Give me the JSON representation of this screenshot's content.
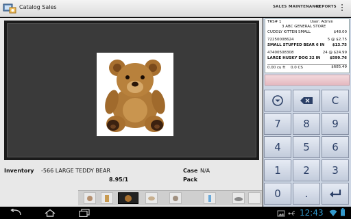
{
  "app": {
    "title": "Catalog Sales",
    "icon": "catalog-app-icon"
  },
  "menu": {
    "sales": "SALES",
    "maintenance": "MAINTENANCE",
    "reports": "REPORTS"
  },
  "product": {
    "image_icon": "teddy-bear-photo",
    "inventory_label": "Inventory",
    "inventory_value": "-566 LARGE TEDDY BEAR",
    "price": "8.95/1",
    "case_label": "Case",
    "case_value": "N/A",
    "pack_label": "Pack"
  },
  "thumbnails": [
    {
      "name": "thumb-1"
    },
    {
      "name": "thumb-2"
    },
    {
      "name": "thumb-3"
    },
    {
      "name": "thumb-4"
    },
    {
      "name": "thumb-5"
    },
    {
      "name": "thumb-6"
    },
    {
      "name": "thumb-7"
    },
    {
      "name": "thumb-8"
    }
  ],
  "receipt": {
    "trs": "TRS# 1",
    "user": "User: Admin",
    "store": "3  ABC GENERAL STORE",
    "lines": [
      {
        "left": "CUDDLY KITTEN SMALL",
        "right": "$48.00",
        "bold": false
      },
      {
        "left": "72250008624",
        "right": "5 @ $2.75",
        "bold": false
      },
      {
        "left": "SMALL STUFFED BEAR 6 IN",
        "right": "$13.75",
        "bold": true
      },
      {
        "left": "47400508308",
        "right": "24 @ $24.99",
        "bold": false
      },
      {
        "left": "LARGE HUSKY DOG 32 IN",
        "right": "$599.76",
        "bold": true
      }
    ],
    "summary_cuft": "0.00 cu ft",
    "summary_cs": "0.0 CS",
    "summary_total": "$685.49"
  },
  "keypad": {
    "keys": [
      "",
      "",
      "C",
      "7",
      "8",
      "9",
      "4",
      "5",
      "6",
      "1",
      "2",
      "3",
      "0",
      ".",
      ""
    ]
  },
  "status": {
    "time": "12:43"
  },
  "colors": {
    "accent": "#33aacc",
    "keypad_text": "#2b3f66"
  }
}
